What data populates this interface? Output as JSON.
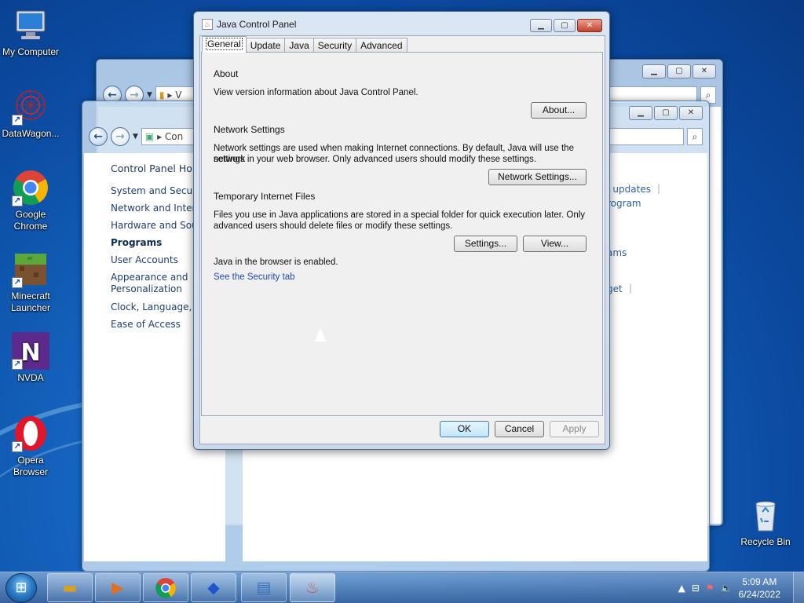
{
  "desktop": {
    "icons": [
      {
        "label": "My Computer",
        "icon": "computer-icon"
      },
      {
        "label": "DataWagon...",
        "icon": "datawagon-icon"
      },
      {
        "label": "Google Chrome",
        "icon": "chrome-icon"
      },
      {
        "label": "Minecraft Launcher",
        "icon": "minecraft-icon"
      },
      {
        "label": "NVDA",
        "icon": "nvda-icon"
      },
      {
        "label": "Opera Browser",
        "icon": "opera-icon"
      },
      {
        "label": "Recycle Bin",
        "icon": "recycle-bin-icon"
      }
    ]
  },
  "bg_window_back": {
    "address": "V"
  },
  "control_panel": {
    "address": "Con",
    "nav": {
      "home": "Control Panel Home",
      "items": [
        "System and Security",
        "Network and Internet",
        "Hardware and Sound",
        "Programs",
        "User Accounts",
        "Appearance and Personalization",
        "Clock, Language, and Region",
        "Ease of Access"
      ],
      "selected": "Programs"
    },
    "main_links": [
      "d updates",
      "rogram",
      "ams",
      "get"
    ]
  },
  "java_control_panel": {
    "title": "Java Control Panel",
    "tabs": [
      "General",
      "Update",
      "Java",
      "Security",
      "Advanced"
    ],
    "active_tab": "General",
    "about": {
      "heading": "About",
      "text": "View version information about Java Control Panel.",
      "button": "About..."
    },
    "network": {
      "heading": "Network Settings",
      "text1": "Network settings are used when making Internet connections. By default, Java will use the network",
      "text2": "settings in your web browser. Only advanced users should modify these settings.",
      "button": "Network Settings..."
    },
    "temp_files": {
      "heading": "Temporary Internet Files",
      "text1": "Files you use in Java applications are stored in a special folder for quick execution later. Only",
      "text2": "advanced users should delete files or modify these settings.",
      "settings_button": "Settings...",
      "view_button": "View..."
    },
    "browser_status": "Java in the browser is enabled.",
    "security_link": "See the Security tab",
    "footer": {
      "ok": "OK",
      "cancel": "Cancel",
      "apply": "Apply"
    }
  },
  "taskbar": {
    "apps": [
      "explorer-icon",
      "media-player-icon",
      "chrome-icon",
      "blue-app-icon",
      "control-panel-icon",
      "java-icon"
    ],
    "active_app": "java-icon",
    "clock": {
      "time": "5:09 AM",
      "date": "6/24/2022"
    }
  }
}
